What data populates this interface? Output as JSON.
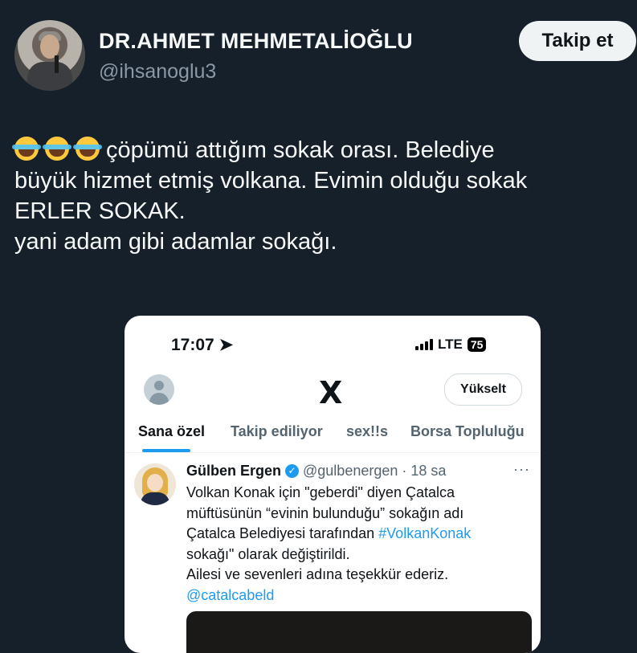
{
  "author": {
    "name": "DR.AHMET MEHMETALİOĞLU",
    "handle": "@ihsanoglu3"
  },
  "follow_button": "Takip et",
  "tweet": {
    "emoji": "😂😂😂",
    "line1": "çöpümü attığım sokak orası. Belediye",
    "line2": "büyük hizmet etmiş volkana. Evimin olduğu sokak",
    "line3": "ERLER SOKAK.",
    "line4": "yani adam gibi adamlar sokağı."
  },
  "screenshot": {
    "status": {
      "time": "17:07",
      "network": "LTE",
      "battery": "75"
    },
    "logo": "X",
    "upgrade_button": "Yükselt",
    "tabs": [
      "Sana özel",
      "Takip ediliyor",
      "sex!!s",
      "Borsa Topluluğu"
    ],
    "embedded_tweet": {
      "name": "Gülben Ergen",
      "handle": "@gulbenergen",
      "time": "18 sa",
      "line1": "Volkan Konak için \"geberdi\" diyen Çatalca",
      "line2": "müftüsünün “evinin bulunduğu” sokağın adı",
      "line3_text": "Çatalca Belediyesi tarafından ",
      "line3_link": "#VolkanKonak",
      "line4": "sokağı\" olarak değiştirildi.",
      "line5": "Ailesi ve sevenleri adına teşekkür ederiz.",
      "mention": "@catalcabeld"
    }
  },
  "colors": {
    "background": "#15202b",
    "link": "#1d9bf0",
    "secondary": "#8b98a5"
  }
}
